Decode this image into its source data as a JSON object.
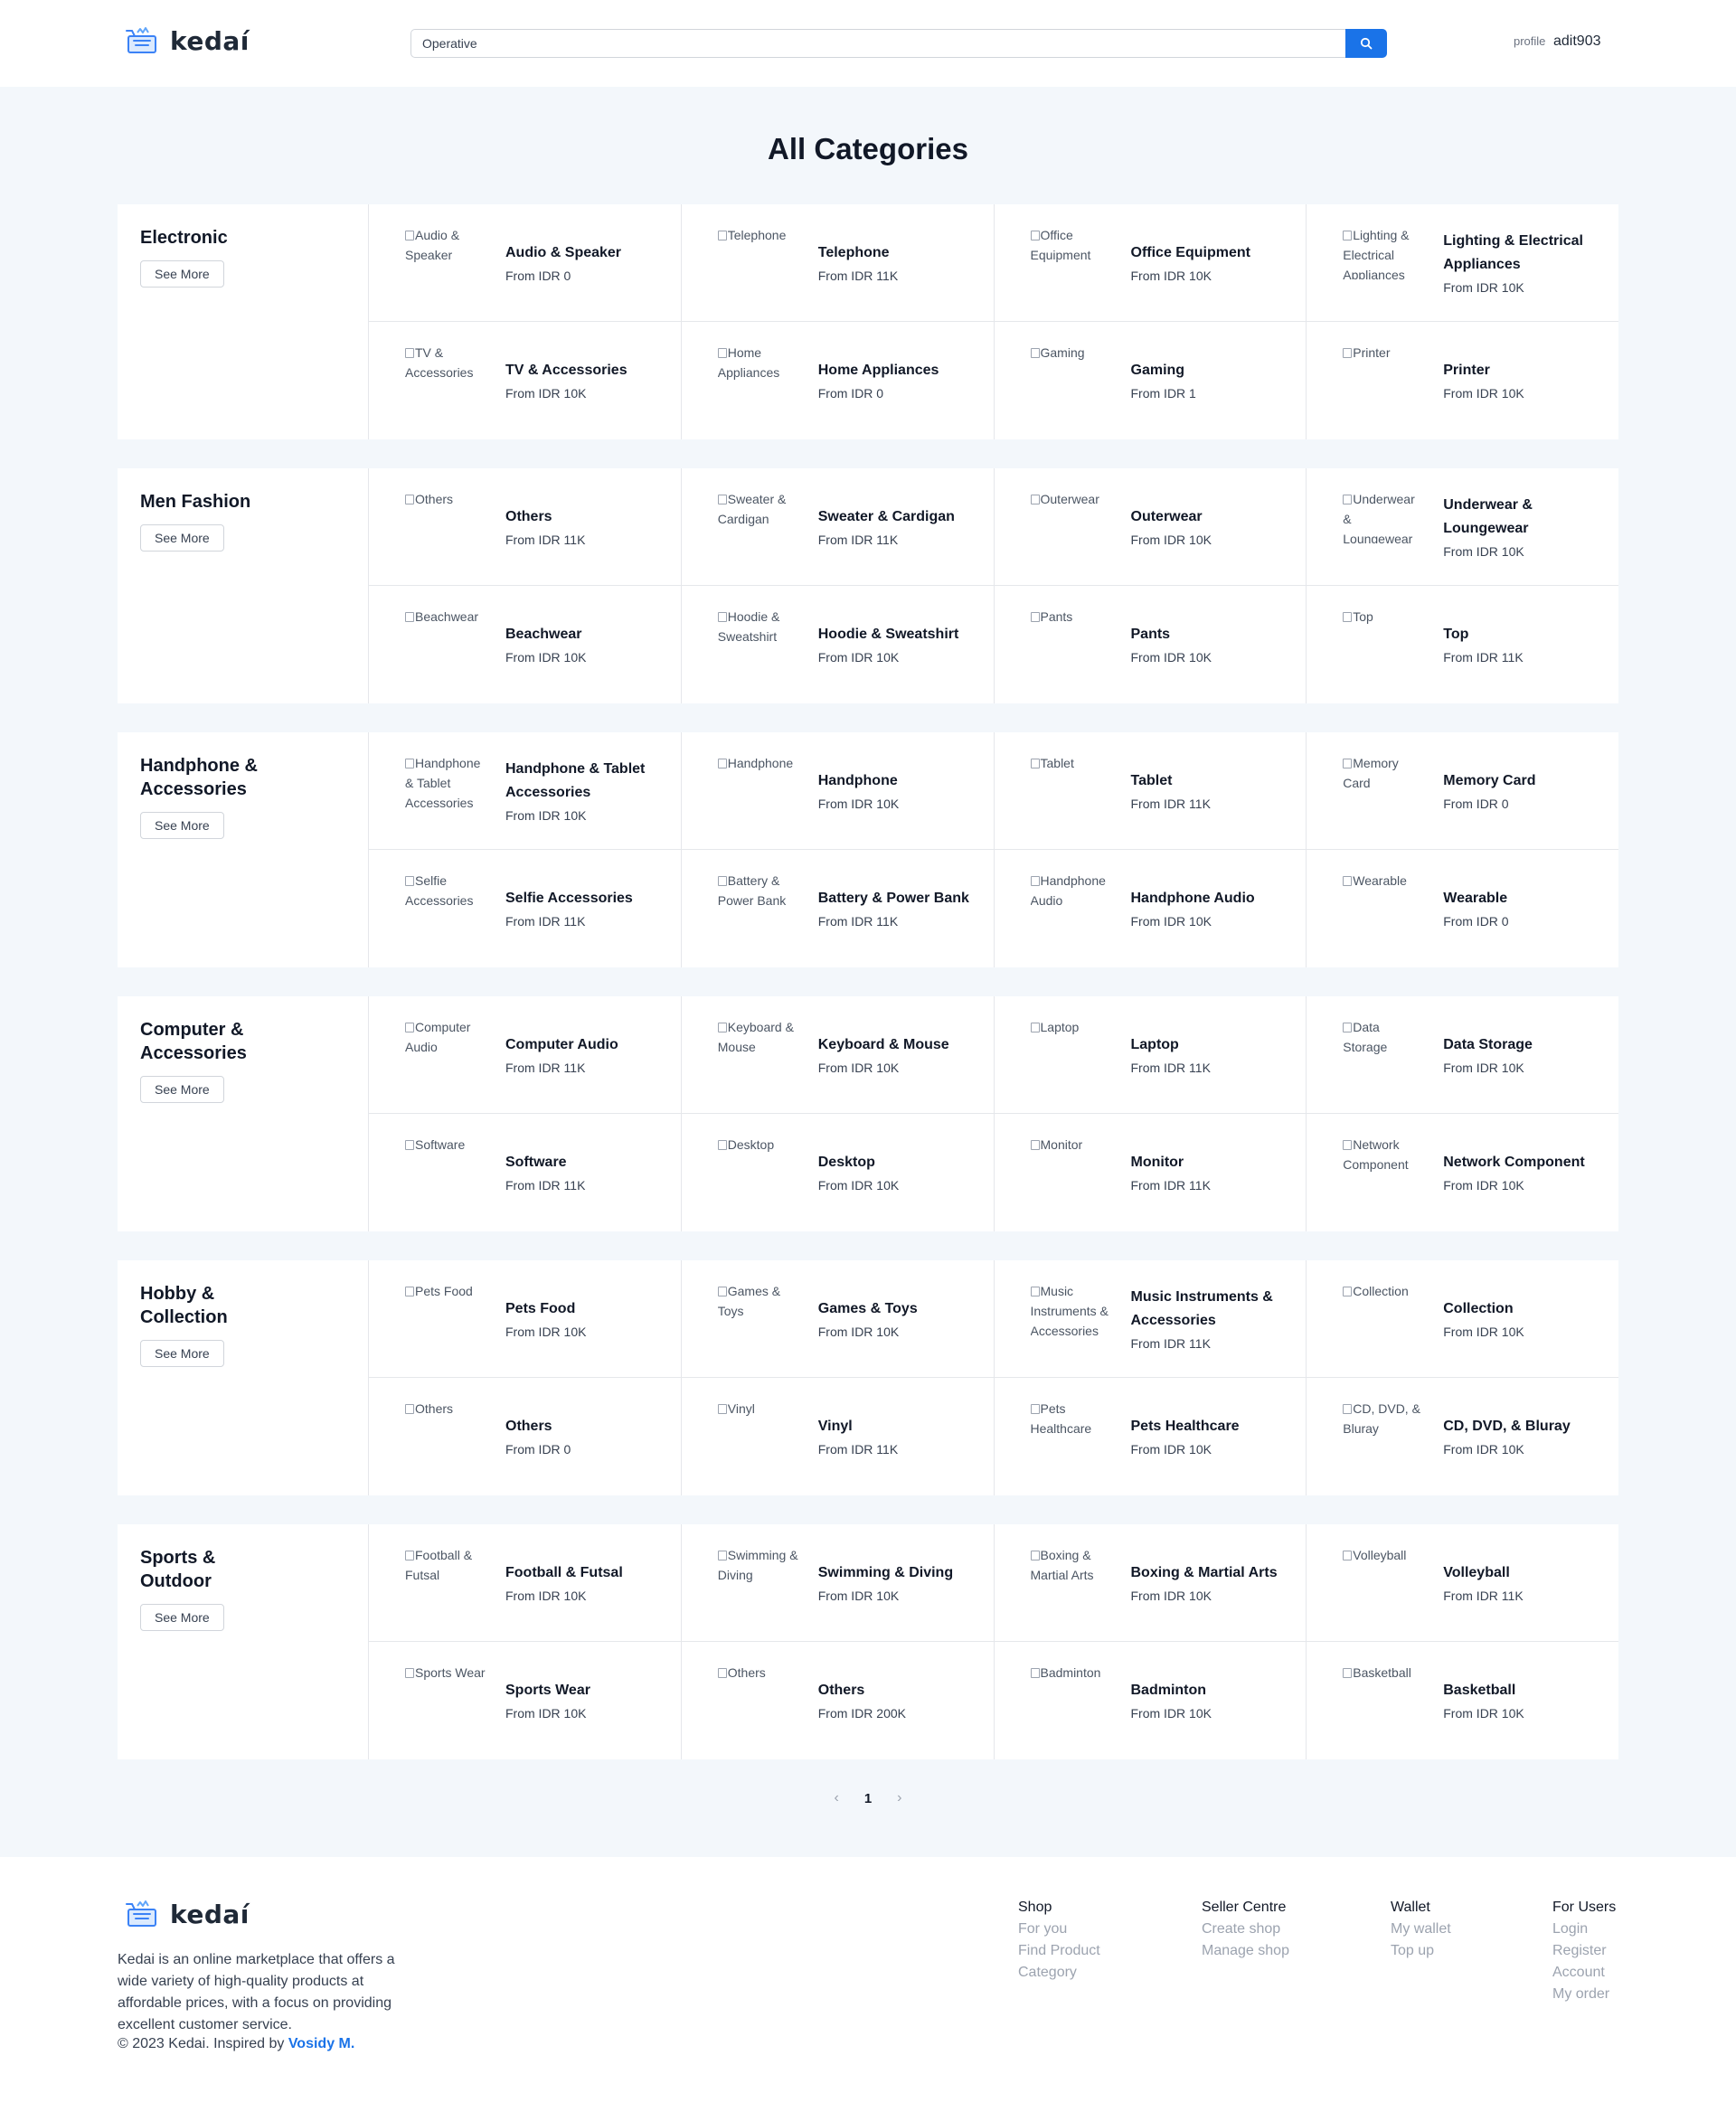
{
  "header": {
    "logo_text": "kedaí",
    "search_value": "Operative",
    "profile_alt": "profile",
    "username": "adit903"
  },
  "page_title": "All Categories",
  "sections": [
    {
      "title": "Electronic",
      "see_more": "See More",
      "items": [
        {
          "name": "Audio & Speaker",
          "price": "From IDR 0",
          "alt": "Audio & Speaker"
        },
        {
          "name": "Telephone",
          "price": "From IDR 11K",
          "alt": "Telephone"
        },
        {
          "name": "Office Equipment",
          "price": "From IDR 10K",
          "alt": "Office Equipment"
        },
        {
          "name": "Lighting & Electrical Appliances",
          "price": "From IDR 10K",
          "alt": "Lighting & Electrical Appliances"
        },
        {
          "name": "TV & Accessories",
          "price": "From IDR 10K",
          "alt": "TV & Accessories"
        },
        {
          "name": "Home Appliances",
          "price": "From IDR 0",
          "alt": "Home Appliances"
        },
        {
          "name": "Gaming",
          "price": "From IDR 1",
          "alt": "Gaming"
        },
        {
          "name": "Printer",
          "price": "From IDR 10K",
          "alt": "Printer"
        }
      ]
    },
    {
      "title": "Men Fashion",
      "see_more": "See More",
      "items": [
        {
          "name": "Others",
          "price": "From IDR 11K",
          "alt": "Others"
        },
        {
          "name": "Sweater & Cardigan",
          "price": "From IDR 11K",
          "alt": "Sweater & Cardigan"
        },
        {
          "name": "Outerwear",
          "price": "From IDR 10K",
          "alt": "Outerwear"
        },
        {
          "name": "Underwear & Loungewear",
          "price": "From IDR 10K",
          "alt": "Underwear & Loungewear"
        },
        {
          "name": "Beachwear",
          "price": "From IDR 10K",
          "alt": "Beachwear"
        },
        {
          "name": "Hoodie & Sweatshirt",
          "price": "From IDR 10K",
          "alt": "Hoodie & Sweatshirt"
        },
        {
          "name": "Pants",
          "price": "From IDR 10K",
          "alt": "Pants"
        },
        {
          "name": "Top",
          "price": "From IDR 11K",
          "alt": "Top"
        }
      ]
    },
    {
      "title": "Handphone & Accessories",
      "see_more": "See More",
      "items": [
        {
          "name": "Handphone & Tablet Accessories",
          "price": "From IDR 10K",
          "alt": "Handphone & Tablet Accessories"
        },
        {
          "name": "Handphone",
          "price": "From IDR 10K",
          "alt": "Handphone"
        },
        {
          "name": "Tablet",
          "price": "From IDR 11K",
          "alt": "Tablet"
        },
        {
          "name": "Memory Card",
          "price": "From IDR 0",
          "alt": "Memory Card"
        },
        {
          "name": "Selfie Accessories",
          "price": "From IDR 11K",
          "alt": "Selfie Accessories"
        },
        {
          "name": "Battery & Power Bank",
          "price": "From IDR 11K",
          "alt": "Battery & Power Bank"
        },
        {
          "name": "Handphone Audio",
          "price": "From IDR 10K",
          "alt": "Handphone Audio"
        },
        {
          "name": "Wearable",
          "price": "From IDR 0",
          "alt": "Wearable"
        }
      ]
    },
    {
      "title": "Computer & Accessories",
      "see_more": "See More",
      "items": [
        {
          "name": "Computer Audio",
          "price": "From IDR 11K",
          "alt": "Computer Audio"
        },
        {
          "name": "Keyboard & Mouse",
          "price": "From IDR 10K",
          "alt": "Keyboard & Mouse"
        },
        {
          "name": "Laptop",
          "price": "From IDR 11K",
          "alt": "Laptop"
        },
        {
          "name": "Data Storage",
          "price": "From IDR 10K",
          "alt": "Data Storage"
        },
        {
          "name": "Software",
          "price": "From IDR 11K",
          "alt": "Software"
        },
        {
          "name": "Desktop",
          "price": "From IDR 10K",
          "alt": "Desktop"
        },
        {
          "name": "Monitor",
          "price": "From IDR 11K",
          "alt": "Monitor"
        },
        {
          "name": "Network Component",
          "price": "From IDR 10K",
          "alt": "Network Component"
        }
      ]
    },
    {
      "title": "Hobby & Collection",
      "see_more": "See More",
      "items": [
        {
          "name": "Pets Food",
          "price": "From IDR 10K",
          "alt": "Pets Food"
        },
        {
          "name": "Games & Toys",
          "price": "From IDR 10K",
          "alt": "Games & Toys"
        },
        {
          "name": "Music Instruments & Accessories",
          "price": "From IDR 11K",
          "alt": "Music Instruments & Accessories"
        },
        {
          "name": "Collection",
          "price": "From IDR 10K",
          "alt": "Collection"
        },
        {
          "name": "Others",
          "price": "From IDR 0",
          "alt": "Others"
        },
        {
          "name": "Vinyl",
          "price": "From IDR 11K",
          "alt": "Vinyl"
        },
        {
          "name": "Pets Healthcare",
          "price": "From IDR 10K",
          "alt": "Pets Healthcare"
        },
        {
          "name": "CD, DVD, & Bluray",
          "price": "From IDR 10K",
          "alt": "CD, DVD, & Bluray"
        }
      ]
    },
    {
      "title": "Sports & Outdoor",
      "see_more": "See More",
      "items": [
        {
          "name": "Football & Futsal",
          "price": "From IDR 10K",
          "alt": "Football & Futsal"
        },
        {
          "name": "Swimming & Diving",
          "price": "From IDR 10K",
          "alt": "Swimming & Diving"
        },
        {
          "name": "Boxing & Martial Arts",
          "price": "From IDR 10K",
          "alt": "Boxing & Martial Arts"
        },
        {
          "name": "Volleyball",
          "price": "From IDR 11K",
          "alt": "Volleyball"
        },
        {
          "name": "Sports Wear",
          "price": "From IDR 10K",
          "alt": "Sports Wear"
        },
        {
          "name": "Others",
          "price": "From IDR 200K",
          "alt": "Others"
        },
        {
          "name": "Badminton",
          "price": "From IDR 10K",
          "alt": "Badminton"
        },
        {
          "name": "Basketball",
          "price": "From IDR 10K",
          "alt": "Basketball"
        }
      ]
    }
  ],
  "pagination": {
    "prev": "‹",
    "current": "1",
    "next": "›"
  },
  "footer": {
    "logo_text": "kedaí",
    "description": "Kedai is an online marketplace that offers a wide variety of high-quality products at affordable prices, with a focus on providing excellent customer service.",
    "copyright": "© 2023 Kedai. Inspired by",
    "inspired_name": "Vosidy M.",
    "columns": [
      {
        "title": "Shop",
        "links": [
          "For you",
          "Find Product",
          "Category"
        ]
      },
      {
        "title": "Seller Centre",
        "links": [
          "Create shop",
          "Manage shop"
        ]
      },
      {
        "title": "Wallet",
        "links": [
          "My wallet",
          "Top up"
        ]
      },
      {
        "title": "For Users",
        "links": [
          "Login",
          "Register",
          "Account",
          "My order"
        ]
      }
    ]
  },
  "colors": {
    "accent": "#1a73e8",
    "page_background": "#f3f7fb",
    "logo_blue": "#60a5fa"
  }
}
